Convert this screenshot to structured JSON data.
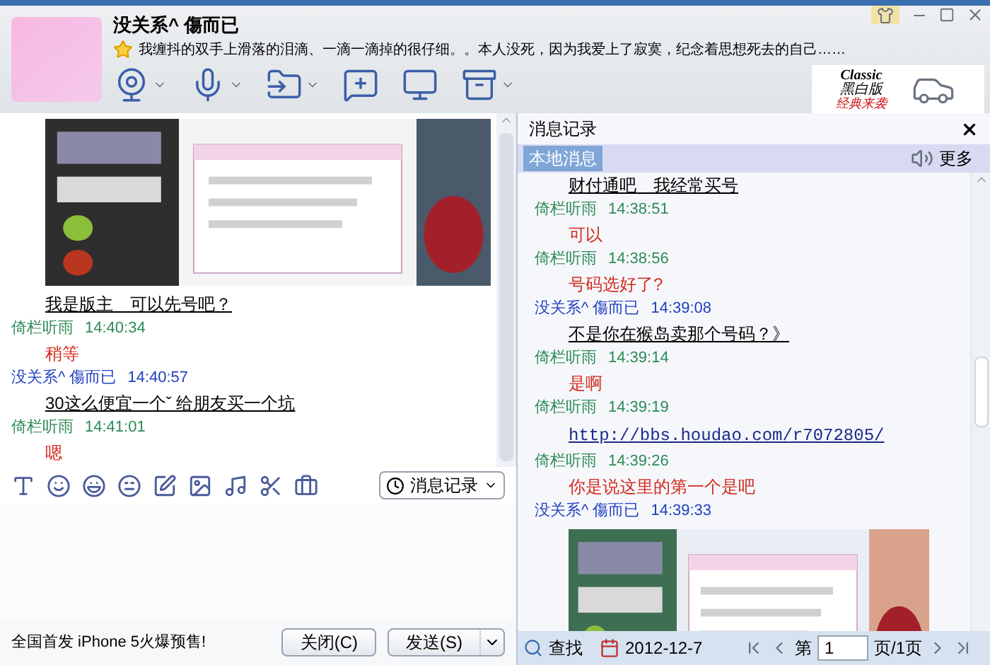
{
  "window": {
    "title": "没关系^ 傷而已",
    "signature": "我缠抖的双手上滑落的泪滴、一滴一滴掉的很仔细。。本人没死，因为我爱上了寂寞，纪念着思想死去的自己……"
  },
  "ad": {
    "lines": [
      "Classic",
      "黑白版",
      "经典来袭"
    ]
  },
  "chat": {
    "messages": [
      {
        "kind": "picture"
      },
      {
        "kind": "self_text",
        "text": "我是版主　可以先号吧？"
      },
      {
        "kind": "friend_header",
        "name": "倚栏听雨",
        "time": "14:40:34"
      },
      {
        "kind": "friend_text",
        "text": "稍等"
      },
      {
        "kind": "self_header",
        "name": "没关系^ 傷而已",
        "time": "14:40:57"
      },
      {
        "kind": "self_text",
        "text": "30这么便宜一个ˇ 给朋友买一个坑"
      },
      {
        "kind": "friend_header",
        "name": "倚栏听雨",
        "time": "14:41:01"
      },
      {
        "kind": "friend_text",
        "text": "嗯"
      }
    ]
  },
  "compose": {
    "history_button": "消息记录",
    "ad_text": "全国首发 iPhone 5火爆预售!",
    "buttons": [
      "关闭(C)",
      "发送(S)"
    ]
  },
  "history": {
    "title": "消息记录",
    "tabs": [
      {
        "label": "本地消息",
        "selected": true
      }
    ],
    "more": "更多",
    "messages": [
      {
        "kind": "self_text",
        "text": "财付通吧　我经常买号"
      },
      {
        "kind": "friend_header",
        "name": "倚栏听雨",
        "time": "14:38:51"
      },
      {
        "kind": "friend_text",
        "text": "可以"
      },
      {
        "kind": "friend_header",
        "name": "倚栏听雨",
        "time": "14:38:56"
      },
      {
        "kind": "friend_text",
        "text": "号码选好了?"
      },
      {
        "kind": "self_header",
        "name": "没关系^ 傷而已",
        "time": "14:39:08"
      },
      {
        "kind": "self_text",
        "text": "不是你在猴岛卖那个号码？》"
      },
      {
        "kind": "friend_header",
        "name": "倚栏听雨",
        "time": "14:39:14"
      },
      {
        "kind": "friend_text",
        "text": "是啊"
      },
      {
        "kind": "friend_header",
        "name": "倚栏听雨",
        "time": "14:39:19"
      },
      {
        "kind": "link",
        "text": "http://bbs.houdao.com/r7072805/"
      },
      {
        "kind": "friend_header",
        "name": "倚栏听雨",
        "time": "14:39:26"
      },
      {
        "kind": "friend_text",
        "text": "你是说这里的第一个是吧"
      },
      {
        "kind": "self_header",
        "name": "没关系^ 傷而已",
        "time": "14:39:33"
      },
      {
        "kind": "picture"
      }
    ],
    "search": "查找",
    "date": "2012-12-7",
    "page_prefix": "第",
    "page": "1",
    "page_suffix": "页/1页"
  }
}
